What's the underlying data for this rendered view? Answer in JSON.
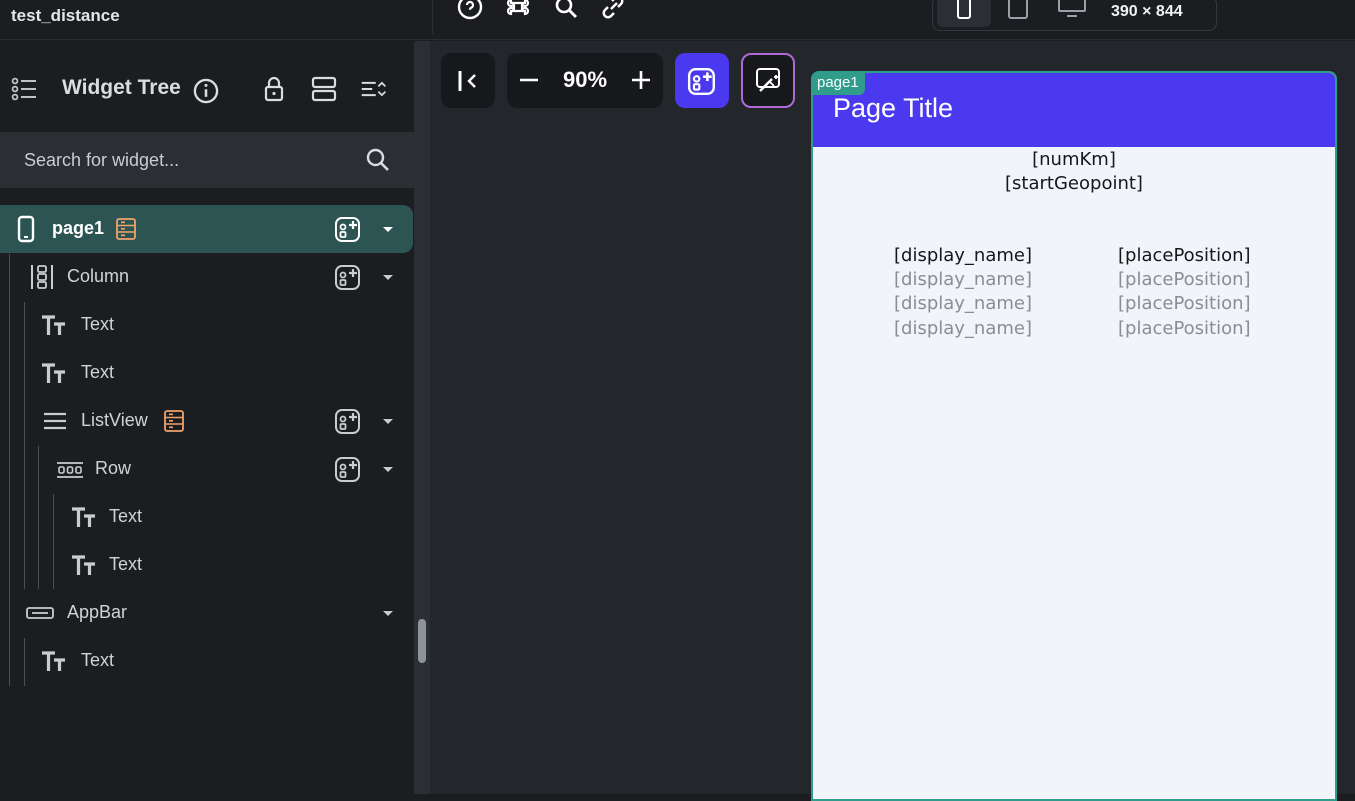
{
  "topbar": {
    "project_name": "test_distance",
    "icons": [
      "help-icon",
      "command-icon",
      "search-icon",
      "link-icon"
    ],
    "device_size": "390 × 844"
  },
  "widget_tree": {
    "title": "Widget Tree",
    "search_placeholder": "Search for widget...",
    "nodes": [
      {
        "label": "page1",
        "icon": "phone-icon",
        "selected": true
      },
      {
        "label": "Column",
        "icon": "column-icon"
      },
      {
        "label": "Text",
        "icon": "text-icon"
      },
      {
        "label": "Text",
        "icon": "text-icon"
      },
      {
        "label": "ListView",
        "icon": "listview-icon"
      },
      {
        "label": "Row",
        "icon": "row-icon"
      },
      {
        "label": "Text",
        "icon": "text-icon"
      },
      {
        "label": "Text",
        "icon": "text-icon"
      },
      {
        "label": "AppBar",
        "icon": "appbar-icon"
      },
      {
        "label": "Text",
        "icon": "text-icon"
      }
    ]
  },
  "canvas": {
    "zoom": "90%",
    "page_tag": "page1",
    "colors": {
      "primary": "#4b39ef",
      "page_bg": "#f1f4f8",
      "selection": "#2f9c8c"
    }
  },
  "preview": {
    "page_title": "Page Title",
    "num_km": "[numKm]",
    "start_geopoint": "[startGeopoint]",
    "list_items": [
      {
        "name": "[display_name]",
        "position": "[placePosition]"
      },
      {
        "name": "[display_name]",
        "position": "[placePosition]"
      },
      {
        "name": "[display_name]",
        "position": "[placePosition]"
      },
      {
        "name": "[display_name]",
        "position": "[placePosition]"
      }
    ]
  }
}
